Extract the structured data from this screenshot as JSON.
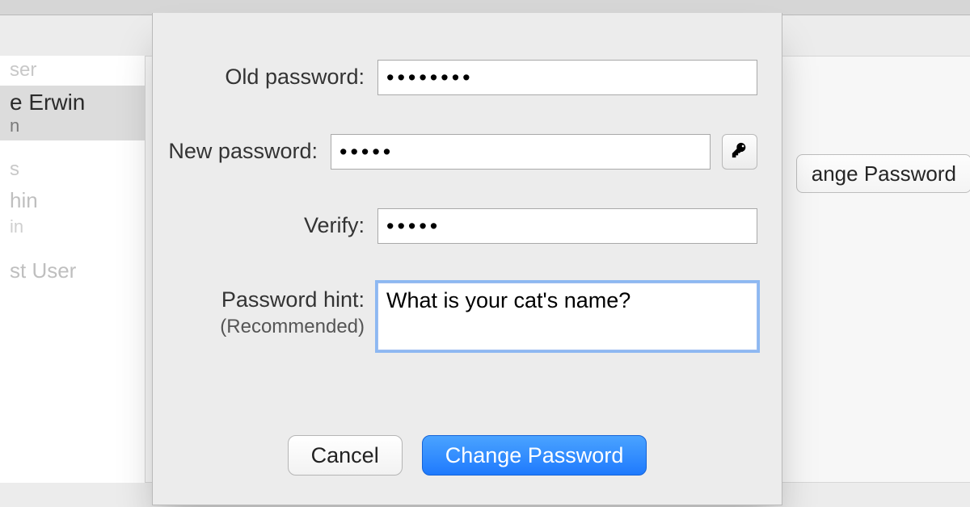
{
  "sidebar": {
    "items": [
      {
        "name": "ser"
      },
      {
        "name": "e Erwin",
        "sub": "n",
        "selected": true
      },
      {
        "name": "s"
      },
      {
        "name": "hin",
        "sub": "in"
      },
      {
        "name": "st User"
      }
    ]
  },
  "background": {
    "change_password_button": "ange Password"
  },
  "sheet": {
    "labels": {
      "old_password": "Old password:",
      "new_password": "New password:",
      "verify": "Verify:",
      "hint": "Password hint:",
      "hint_sub": "(Recommended)"
    },
    "values": {
      "old_password": "••••••••",
      "new_password": "•••••",
      "verify": "•••••",
      "hint": "What is your cat's name?"
    },
    "icons": {
      "password_assistant": "key-icon"
    },
    "buttons": {
      "cancel": "Cancel",
      "change": "Change Password"
    }
  }
}
